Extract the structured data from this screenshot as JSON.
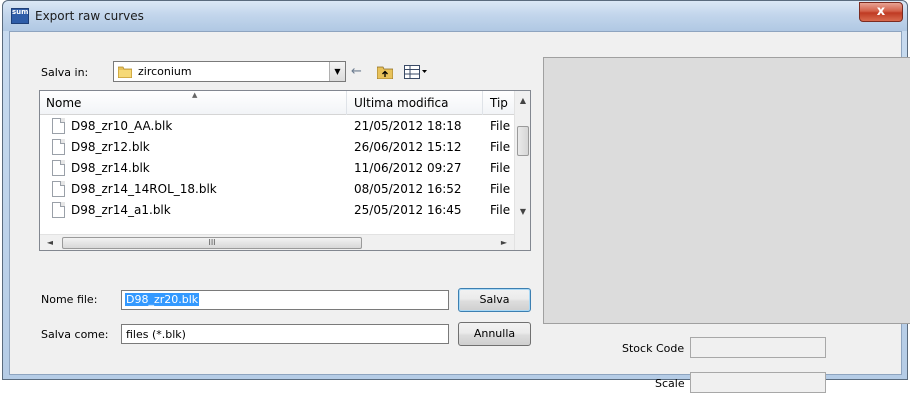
{
  "window": {
    "title": "Export raw curves",
    "app_icon_text": "sum",
    "close_glyph": "x"
  },
  "save_in": {
    "label": "Salva in:",
    "value": "zirconium",
    "icons": [
      "folder-icon",
      "back-arrow-icon",
      "up-folder-icon",
      "view-menu-icon"
    ]
  },
  "file_list": {
    "columns": [
      "Nome",
      "Ultima modifica",
      "Tip"
    ],
    "rows": [
      {
        "name": "D98_zr10_AA.blk",
        "modified": "21/05/2012 18:18",
        "type": "File"
      },
      {
        "name": "D98_zr12.blk",
        "modified": "26/06/2012 15:12",
        "type": "File"
      },
      {
        "name": "D98_zr14.blk",
        "modified": "11/06/2012 09:27",
        "type": "File"
      },
      {
        "name": "D98_zr14_14ROL_18.blk",
        "modified": "08/05/2012 16:52",
        "type": "File"
      },
      {
        "name": "D98_zr14_a1.blk",
        "modified": "25/05/2012 16:45",
        "type": "File"
      }
    ]
  },
  "filename": {
    "label": "Nome file:",
    "value": "D98_zr20.blk"
  },
  "saveas": {
    "label": "Salva come:",
    "value": "files (*.blk)"
  },
  "buttons": {
    "save": "Salva",
    "cancel": "Annulla"
  },
  "fields": {
    "stock_code_label": "Stock Code",
    "stock_code_value": "",
    "scale_label": "Scale",
    "scale_value": ""
  }
}
